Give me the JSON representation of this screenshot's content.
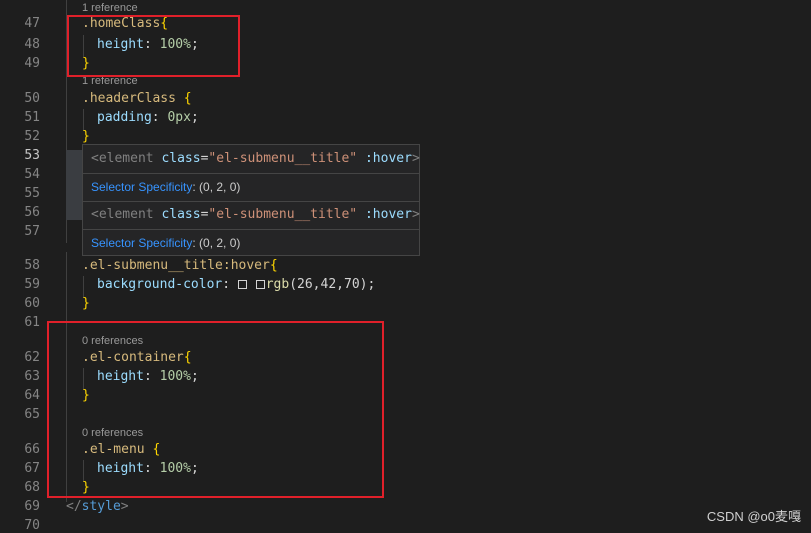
{
  "lines": {
    "n47": "47",
    "n48": "48",
    "n49": "49",
    "n50": "50",
    "n51": "51",
    "n52": "52",
    "n53": "53",
    "n54": "54",
    "n55": "55",
    "n56": "56",
    "n57": "57",
    "n58": "58",
    "n59": "59",
    "n60": "60",
    "n61": "61",
    "n62": "62",
    "n63": "63",
    "n64": "64",
    "n65": "65",
    "n66": "66",
    "n67": "67",
    "n68": "68",
    "n69": "69",
    "n70": "70"
  },
  "code_lens": {
    "home": "1 reference",
    "header": "1 reference",
    "container": "0 references",
    "menu": "0 references"
  },
  "code": {
    "home_selector": ".homeClass",
    "height_prop": "height",
    "colon": ":",
    "hundred": "100%",
    "semi": ";",
    "open_brace": "{",
    "close_brace": "}",
    "header_selector": ".headerClass",
    "padding_prop": "padding",
    "zero_px": "0px",
    "submenu_selector": ".el-submenu__title:hover",
    "bg_prop": "background-color",
    "rgb_fn": "rgb",
    "rgb_args": "(26,42,70)",
    "container_selector": ".el-container",
    "menu_selector": ".el-menu",
    "style_close_open": "</",
    "style_tag": "style",
    "style_close_end": ">"
  },
  "hover_popup": {
    "element_open": "<element",
    "class_attr": "class",
    "equals": "=",
    "class_value": "\"el-submenu__title\"",
    "pseudo": ":hover",
    "gt": ">",
    "specificity_label": "Selector Specificity",
    "specificity_value": ": (0, 2, 0)"
  },
  "watermark": "CSDN @o0麦嘎",
  "colors": {
    "background": "#1e1e1e",
    "selector": "#d7ba7d",
    "property": "#9cdcfe",
    "number": "#b5cea8",
    "annotation_box": "#e0202a",
    "link": "#3794ff"
  }
}
